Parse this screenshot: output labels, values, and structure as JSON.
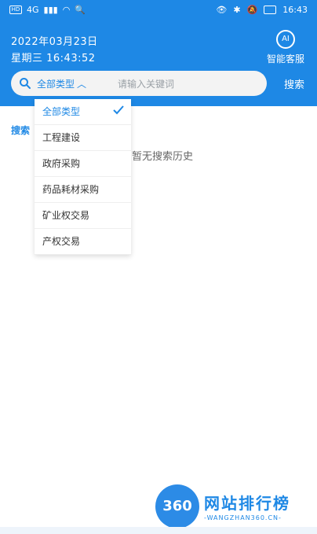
{
  "status_bar": {
    "left_badges": [
      "HD",
      "4G"
    ],
    "time": "16:43"
  },
  "header": {
    "date": "2022年03月23日",
    "weekday_time": "星期三 16:43:52",
    "service_label": "智能客服",
    "service_icon_text": "AI"
  },
  "search": {
    "type_selected": "全部类型",
    "placeholder": "请输入关键词",
    "button_label": "搜索"
  },
  "history": {
    "label": "搜索",
    "empty_text": "暂无搜索历史"
  },
  "dropdown": {
    "options": [
      "全部类型",
      "工程建设",
      "政府采购",
      "药品耗材采购",
      "矿业权交易",
      "产权交易"
    ],
    "selected_index": 0
  },
  "watermark": {
    "logo_text": "360",
    "title": "网站排行榜",
    "subtitle": "-WANGZHAN360.CN-"
  },
  "colors": {
    "primary": "#1e88e5",
    "search_bg": "#f3f3f3",
    "text": "#333333",
    "muted": "#9aa0a6"
  }
}
